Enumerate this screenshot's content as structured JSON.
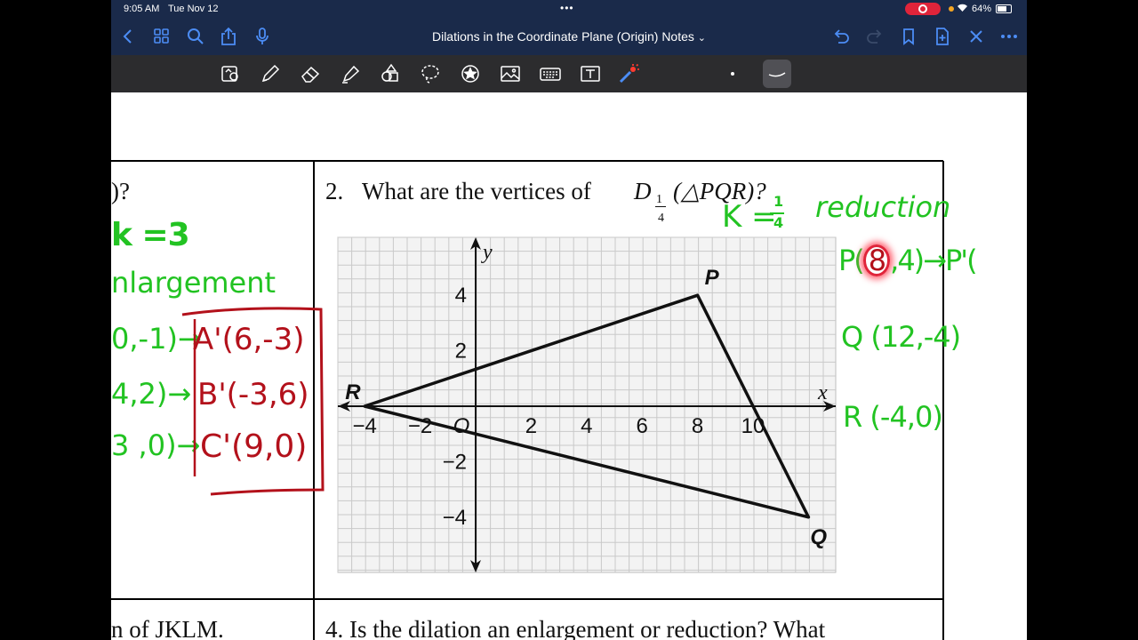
{
  "status_bar": {
    "time": "9:05 AM",
    "date": "Tue Nov 12",
    "battery": "64%"
  },
  "nav_bar": {
    "document_title": "Dilations in the Coordinate Plane (Origin) Notes",
    "title_chevron": "⌄"
  },
  "toolbar": {
    "tools": [
      "pages-icon",
      "pen-icon",
      "eraser-icon",
      "highlighter-icon",
      "shapes-icon",
      "lasso-icon",
      "elements-icon",
      "image-icon",
      "keyboard-icon",
      "textbox-icon",
      "laser-pointer-icon"
    ]
  },
  "colors": {
    "accent": "#4c8df5",
    "nav_bg": "#1a2a4a",
    "toolbar_bg": "#2c2c2e",
    "green_ink": "#22c322",
    "red_ink": "#b3111b"
  },
  "worksheet": {
    "q1_tail": ")?",
    "q2_number": "2.",
    "q2_text": "What are the vertices of",
    "q2_D": "D",
    "q2_sub_num": "1",
    "q2_sub_den": "4",
    "q2_triangle": "(△PQR)?",
    "q3_tail": "n of JKLM.",
    "q4_prefix": "4. Is the di",
    "q4_struck": "lation an enlargement",
    "q4_suffix": " or reduction? What"
  },
  "graph": {
    "x_label": "x",
    "y_label": "y",
    "x_ticks": [
      "−4",
      "−2",
      "O",
      "2",
      "4",
      "6",
      "8",
      "10"
    ],
    "y_ticks": [
      "4",
      "2",
      "−2",
      "−4"
    ],
    "points": [
      {
        "name": "P",
        "x": 8,
        "y": 4
      },
      {
        "name": "Q",
        "x": 12,
        "y": -4
      },
      {
        "name": "R",
        "x": -4,
        "y": 0
      }
    ]
  },
  "handwriting": {
    "left": {
      "k_value": "k =3",
      "type": "nlargement",
      "line_a_left": "0,-1)→",
      "line_a_right": "A'(6,-3)",
      "line_b_left": "4,2)→",
      "line_b_right": "B'(-3,6)",
      "line_c_left": "3 ,0)→",
      "line_c_right": "C'(9,0)"
    },
    "right": {
      "k_label": "K =",
      "k_num": "1",
      "k_den": "4",
      "type": "reduction",
      "p_start": "P(",
      "p_circled": "8",
      "p_end": ",4)→P'(",
      "q_line": "Q (12,-4)",
      "r_line": "R (-4,0)"
    }
  }
}
